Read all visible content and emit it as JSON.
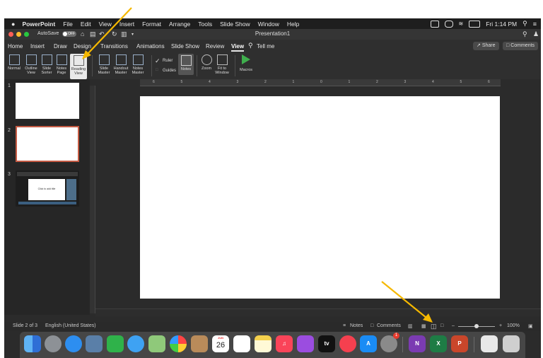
{
  "menubar": {
    "app": "PowerPoint",
    "items": [
      "File",
      "Edit",
      "View",
      "Insert",
      "Format",
      "Arrange",
      "Tools",
      "Slide Show",
      "Window",
      "Help"
    ],
    "clock": "Fri 1:14 PM"
  },
  "titlebar": {
    "autosave_label": "AutoSave",
    "autosave_state": "OFF",
    "document_title": "Presentation1"
  },
  "tabs": [
    "Home",
    "Insert",
    "Draw",
    "Design",
    "Transitions",
    "Animations",
    "Slide Show",
    "Review",
    "View"
  ],
  "active_tab": "View",
  "tell_me": "Tell me",
  "share_label": "Share",
  "comments_label": "Comments",
  "ribbon": {
    "normal": "Normal",
    "outline": "Outline View",
    "slide_sorter": "Slide Sorter",
    "notes_page": "Notes Page",
    "reading_view": "Reading View",
    "slide_master": "Slide Master",
    "handout_master": "Handout Master",
    "notes_master": "Notes Master",
    "ruler": "Ruler",
    "guides": "Guides",
    "notes": "Notes",
    "zoom": "Zoom",
    "fit_to_window": "Fit to Window",
    "macros": "Macros"
  },
  "ruler_numbers": [
    "6",
    "5",
    "4",
    "3",
    "2",
    "1",
    "0",
    "1",
    "2",
    "3",
    "4",
    "5",
    "6"
  ],
  "thumbnails": [
    {
      "number": "1",
      "selected": false
    },
    {
      "number": "2",
      "selected": true
    },
    {
      "number": "3",
      "selected": false,
      "title": "Click to add title"
    }
  ],
  "status": {
    "slide_indicator": "Slide 2 of 3",
    "language": "English (United States)",
    "notes": "Notes",
    "comments": "Comments",
    "zoom": "100%",
    "zoom_level_percent": 100
  },
  "dock": {
    "calendar_month": "JUN",
    "calendar_day": "26",
    "tv_label": "tv",
    "onenote": "N",
    "excel": "X",
    "powerpoint": "P",
    "settings_badge": "1"
  },
  "colors": {
    "annotation_arrow": "#f5b800",
    "selection_border": "#c45a43",
    "background_dark": "#2b2b2b"
  }
}
